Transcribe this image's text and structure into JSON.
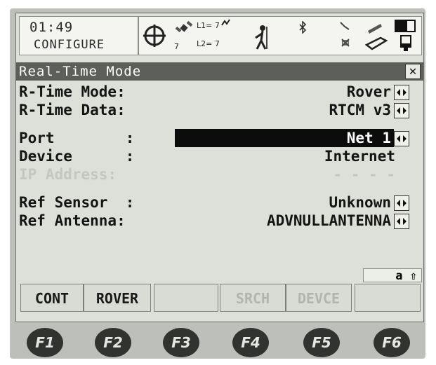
{
  "status": {
    "time": "01:49",
    "mode_label": "CONFIGURE",
    "l1_count": "L1= 7",
    "l2_count": "L2= 7",
    "sat_total": "7"
  },
  "title": "Real-Time Mode",
  "fields": [
    {
      "label": "R-Time Mode:",
      "value": "Rover"
    },
    {
      "label": "R-Time Data:",
      "value": "RTCM v3"
    },
    {
      "label": "Port        :",
      "value": "Net 1"
    },
    {
      "label": "Device      :",
      "value": "Internet"
    },
    {
      "label": "IP Address:",
      "value": "- - - -"
    },
    {
      "label": "Ref Sensor  :",
      "value": "Unknown"
    },
    {
      "label": "Ref Antenna:",
      "value": "ADVNULLANTENNA"
    }
  ],
  "input_mode": "a ⇧",
  "softkeys": [
    {
      "label": "CONT",
      "enabled": true
    },
    {
      "label": "ROVER",
      "enabled": true
    },
    {
      "label": "",
      "enabled": false
    },
    {
      "label": "SRCH",
      "enabled": false
    },
    {
      "label": "DEVCE",
      "enabled": false
    },
    {
      "label": "",
      "enabled": false
    }
  ],
  "function_keys": [
    "F1",
    "F2",
    "F3",
    "F4",
    "F5",
    "F6"
  ],
  "icons": {
    "position_status": "crosshair-icon",
    "satellites": "satellite-icon",
    "mode": "walking-person-icon",
    "bluetooth": "bluetooth-icon",
    "radio": "radio-link-icon",
    "memory": "memory-card-icon",
    "battery": "battery-icon"
  }
}
